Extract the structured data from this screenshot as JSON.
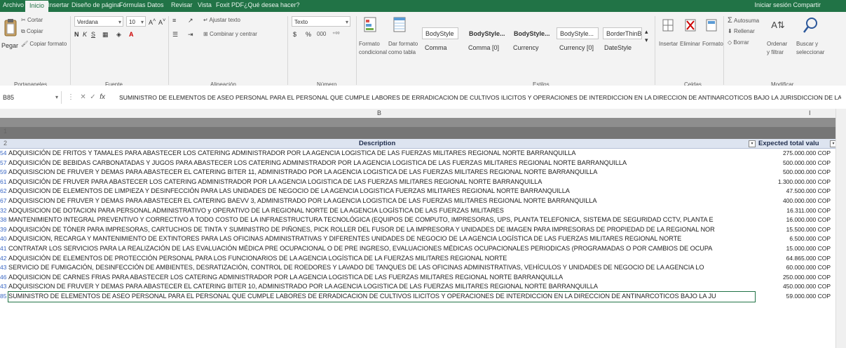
{
  "ribbon_tabs": {
    "items": [
      "Archivo",
      "Inicio",
      "Insertar",
      "Diseño de página",
      "Fórmulas",
      "Datos",
      "Revisar",
      "Vista",
      "Foxit PDF",
      "¿Qué desea hacer?"
    ],
    "active_index": 1,
    "user": "Iniciar sesión  Compartir"
  },
  "clipboard": {
    "paste_label": "Pegar",
    "cut_label": "Cortar",
    "copy_label": "Copiar",
    "format_painter_label": "Copiar formato",
    "group_label": "Portapapeles"
  },
  "font": {
    "name_value": "Verdana",
    "size_value": "10",
    "group_label": "Fuente"
  },
  "alignment": {
    "wrap_label": "Ajustar texto",
    "merge_label": "Combinar y centrar",
    "group_label": "Alineación"
  },
  "number": {
    "format_value": "Texto",
    "currency_symbol": "$",
    "percent_symbol": "%",
    "thousands_symbol": "000",
    "group_label": "Número"
  },
  "styles": {
    "conditional_label": "Formato condicional",
    "table_label": "Dar formato como tabla",
    "row1": [
      "BodyStyle",
      "BodyStyle...",
      "BodyStyle...",
      "BodyStyle...",
      "BorderThinB"
    ],
    "row2": [
      "Comma",
      "Comma [0]",
      "Currency",
      "Currency [0]",
      "DateStyle"
    ],
    "group_label": "Estilos"
  },
  "cells": {
    "insert_label": "Insertar",
    "delete_label": "Eliminar",
    "format_label": "Formato",
    "group_label": "Celdas"
  },
  "editing": {
    "autosum_label": "Autosuma",
    "fill_label": "Rellenar",
    "clear_label": "Borrar",
    "sort_label": "Ordenar y filtrar",
    "find_label": "Buscar y seleccionar",
    "group_label": "Modificar"
  },
  "formula_bar": {
    "name_box": "B85",
    "content": "SUMINISTRO DE ELEMENTOS DE ASEO PERSONAL PARA EL PERSONAL QUE CUMPLE LABORES DE ERRADICACION DE CULTIVOS ILICITOS Y OPERACIONES DE INTERDICCION EN LA DIRECCION DE ANTINARCOTICOS BAJO LA JURISDICCION DE LA REGIONAL NORTE"
  },
  "columns": {
    "b_label": "B",
    "i_label": "I"
  },
  "row_headers": {
    "r1": "1",
    "r2": "2"
  },
  "table": {
    "header_description": "Description",
    "header_value": "Expected total valu",
    "rows": [
      {
        "num": "54",
        "desc": "ADQUISICIÓN DE FRITOS Y TAMALES PARA ABASTECER LOS CATERING ADMINISTRADOR POR LA AGENCIA LOGISTICA DE LAS FUERZAS MILITARES REGIONAL NORTE BARRANQUILLA",
        "val": "275.000.000 COP"
      },
      {
        "num": "57",
        "desc": "ADQUISICIÓN DE BEBIDAS CARBONATADAS Y JUGOS PARA ABASTECER LOS CATERING ADMINISTRADOR POR LA AGENCIA LOGISTICA DE LAS FUERZAS MILITARES REGIONAL NORTE BARRANQUILLA",
        "val": "500.000.000 COP"
      },
      {
        "num": "59",
        "desc": "ADQUISISCION DE FRUVER Y DEMAS PARA ABASTECER EL CATERING  BITER 11, ADMINISTRADO POR LA AGENCIA LOGISTICA DE LAS FUERZAS MILITARES REGIONAL NORTE BARRANQUILLA",
        "val": "500.000.000 COP"
      },
      {
        "num": "61",
        "desc": "ADQUISICIÓN DE FRUVER PARA ABASTECER LOS CATERING ADMINISTRADOR POR LA AGENCIA LOGISTICA DE LAS FUERZAS MILITARES REGIONAL NORTE BARRANQUILLA",
        "val": "1.300.000.000 COP"
      },
      {
        "num": "62",
        "desc": "ADQUISICION DE ELEMENTOS DE LIMPIEZA Y DESINFECCIÓN PARA LAS UNIDADES DE NEGOCIO DE LA AGENCIA LOGISTICA FUERZAS MILITARES REGIONAL NORTE BARRANQUILLA",
        "val": "47.500.000 COP"
      },
      {
        "num": "67",
        "desc": "ADQUISISCION DE FRUVER Y DEMAS PARA ABASTECER EL CATERING  BAEVV 3, ADMINISTRADO POR LA AGENCIA LOGISTICA DE LAS FUERZAS MILITARES REGIONAL NORTE BARRANQUILLA",
        "val": "400.000.000 COP"
      },
      {
        "num": "32",
        "desc": "ADQUISICION DE DOTACION PARA PERSONAL ADMINISTRATIVO  y OPERATIVO DE LA REGIONAL  NORTE  DE LA AGENCIA LOGÍSTICA DE LAS FUERZAS MILITARES",
        "val": "16.311.000 COP"
      },
      {
        "num": "38",
        "desc": "MANTENIMIENTO INTEGRAL PREVENTIVO Y CORRECTIVO A TODO COSTO DE LA INFRAESTRUCTURA TECNOLÓGICA (EQUIPOS DE COMPUTO, IMPRESORAS, UPS, PLANTA TELEFONICA, SISTEMA DE SEGURIDAD CCTV, PLANTA E",
        "val": "16.000.000 COP"
      },
      {
        "num": "39",
        "desc": "ADQUISICIÓN DE TÓNER PARA IMPRESORAS, CARTUCHOS DE TINTA Y SUMINISTRO DE PIÑONES, PICK ROLLER DEL FUSOR DE LA IMPRESORA Y UNIDADES DE IMAGEN PARA IMPRESORAS DE PROPIEDAD DE LA REGIONAL NOR",
        "val": "15.500.000 COP"
      },
      {
        "num": "40",
        "desc": "ADQUISICION, RECARGA  Y MANTENIMIENTO DE EXTINTORES PARA LAS OFICINAS ADMINISTRATIVAS Y DIFERENTES UNIDADES DE NEGOCIO DE LA AGENCIA LOGÍSTICA DE LAS FUERZAS MILITARES REGIONAL NORTE",
        "val": "6.500.000 COP"
      },
      {
        "num": "41",
        "desc": "CONTRATAR LOS SERVICIOS PARA LA REALIZACIÓN DE LAS EVALUACIÓN MÉDICA PRE OCUPACIONAL O DE PRE INGRESO, EVALUACIONES MÉDICAS OCUPACIONALES PERIODICAS (PROGRAMADAS O POR CAMBIOS DE OCUPA",
        "val": "15.000.000 COP"
      },
      {
        "num": "42",
        "desc": "ADQUISICIÓN DE ELEMENTOS DE PROTECCIÓN PERSONAL PARA LOS FUNCIONARIOS DE LA AGENCIA LOGÍSTICA DE LA FUERZAS MILITARES REGIONAL NORTE",
        "val": "64.865.000 COP"
      },
      {
        "num": "43",
        "desc": "SERVICIO DE FUMIGACIÓN, DESINFECCIÓN DE AMBIENTES, DESRATIZACIÓN, CONTROL DE ROEDORES Y LAVADO DE TANQUES DE LAS OFICINAS ADMINISTRATIVAS, VEHÍCULOS Y UNIDADES DE NEGOCIO DE LA  AGENCIA LO",
        "val": "60.000.000 COP"
      },
      {
        "num": "46",
        "desc": "ADQUISICION DE CARNES FRIAS PARA ABASTECER LOS CATERING ADMINISTRADOR POR LA AGENCIA LOGISTICA DE LAS FUERZAS MILITARES REGIONAL NORTE BARRANQUILLA",
        "val": "250.000.000 COP"
      },
      {
        "num": "43",
        "desc": "ADQUISISCION DE FRUVER Y DEMAS PARA ABASTECER EL CATERING  BITER 10, ADMINISTRADO POR LA AGENCIA LOGISTICA DE LAS FUERZAS MILITARES REGIONAL NORTE BARRANQUILLA",
        "val": "450.000.000 COP"
      },
      {
        "num": "85",
        "desc": "SUMINISTRO DE ELEMENTOS DE ASEO PERSONAL PARA EL PERSONAL QUE CUMPLE LABORES DE ERRADICACION DE CULTIVOS ILICITOS Y OPERACIONES DE INTERDICCION EN LA DIRECCION DE ANTINARCOTICOS BAJO LA JU",
        "val": "59.000.000 COP"
      }
    ]
  },
  "colors": {
    "accent": "#217346",
    "header_fill": "#dde4f0",
    "band_gray": "#767676",
    "row_number": "#3a67c4"
  }
}
